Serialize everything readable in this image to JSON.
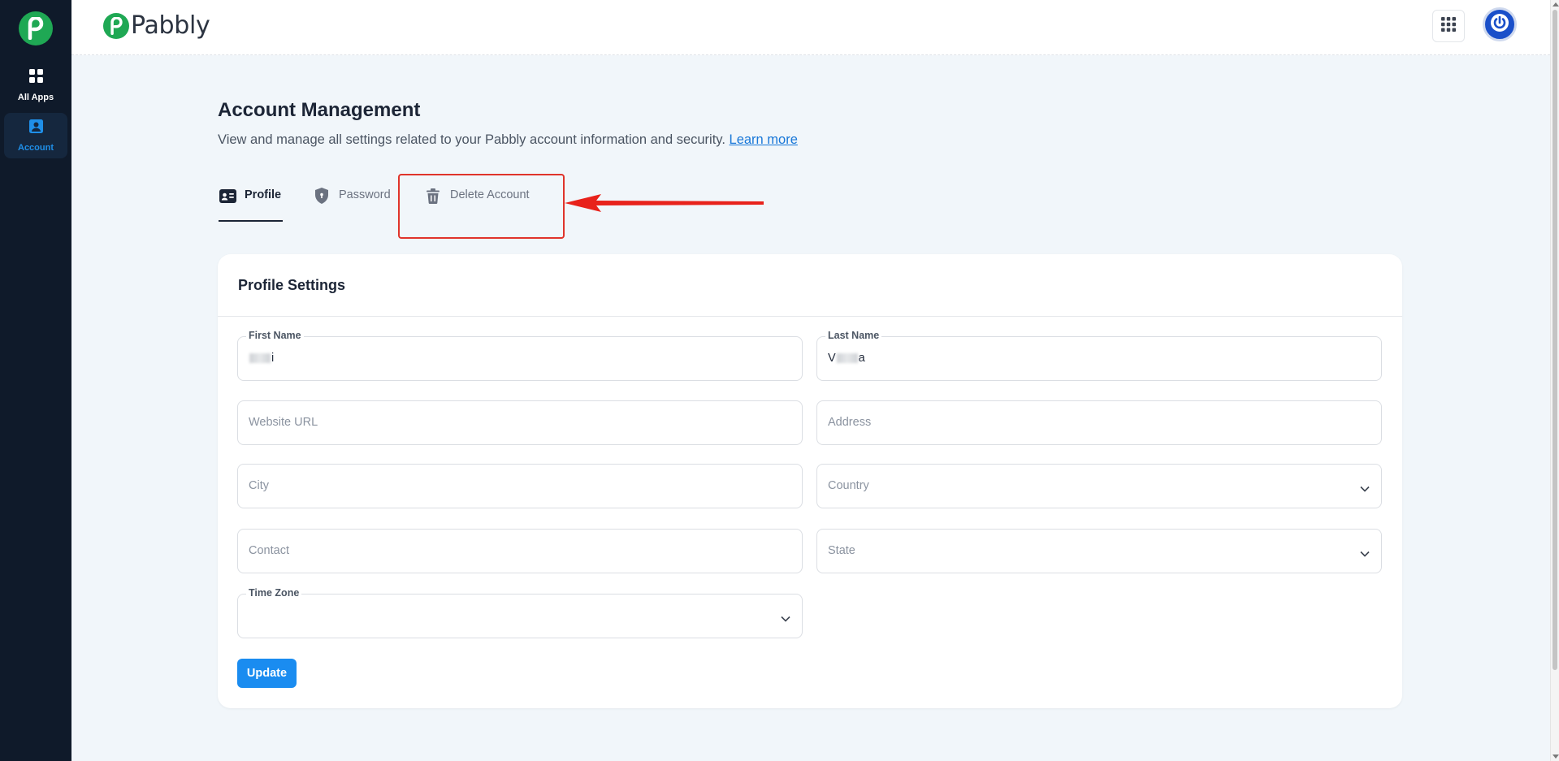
{
  "sidebar": {
    "logo_icon": "pabbly-p-icon",
    "items": [
      {
        "label": "All Apps",
        "icon": "grid-icon"
      },
      {
        "label": "Account",
        "icon": "account-icon",
        "active": true
      }
    ]
  },
  "header": {
    "brand": "Pabbly",
    "apps_icon": "apps-grid-icon",
    "avatar_icon": "power-icon"
  },
  "page": {
    "title": "Account Management",
    "description": "View and manage all settings related to your Pabbly account information and security.",
    "learn_more": "Learn more"
  },
  "tabs": [
    {
      "label": "Profile",
      "icon": "id-card-icon",
      "active": true
    },
    {
      "label": "Password",
      "icon": "shield-icon"
    },
    {
      "label": "Delete Account",
      "icon": "trash-icon"
    }
  ],
  "profile": {
    "title": "Profile Settings",
    "first_name_label": "First Name",
    "first_name_suffix": "i",
    "last_name_label": "Last Name",
    "last_name_prefix": "V",
    "last_name_suffix": "a",
    "website_placeholder": "Website URL",
    "address_placeholder": "Address",
    "city_placeholder": "City",
    "country_placeholder": "Country",
    "contact_placeholder": "Contact",
    "state_placeholder": "State",
    "timezone_label": "Time Zone",
    "update_label": "Update"
  },
  "colors": {
    "brand_green": "#1fa854",
    "accent_blue": "#1a8cf0",
    "sidebar_bg": "#0f1a2a",
    "highlight_red": "#e0342b"
  }
}
